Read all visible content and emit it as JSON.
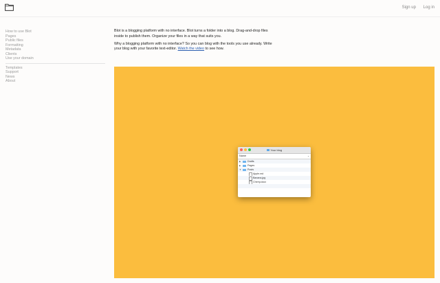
{
  "header": {
    "signup_label": "Sign up",
    "login_label": "Log in"
  },
  "sidebar": {
    "group1": [
      "How to use Blot",
      "Pages",
      "Public files",
      "Formatting",
      "Metadata",
      "Clients",
      "Use your domain"
    ],
    "group2": [
      "Templates",
      "Support",
      "News",
      "About"
    ]
  },
  "intro": {
    "paragraph1": "Blot is a blogging platform with no interface. Blot turns a folder into a blog. Drag-and-drop files inside to publish them. Organize your files in a way that suits you.",
    "paragraph2_prefix": "Why a blogging platform with no interface? So you can blog with the tools you use already. Write your blog with your favorite text-editor. ",
    "video_link": "Watch the video",
    "paragraph2_suffix": " to see how."
  },
  "video": {
    "background_color": "#fbbd3e",
    "finder": {
      "title": "Your blog",
      "column_header": "Name",
      "rows": [
        {
          "name": "Drafts",
          "kind": "folder",
          "state": "collapsed"
        },
        {
          "name": "Pages",
          "kind": "folder",
          "state": "collapsed"
        },
        {
          "name": "Posts",
          "kind": "folder",
          "state": "expanded"
        },
        {
          "name": "Apple.md",
          "kind": "file"
        },
        {
          "name": "Banana.jpg",
          "kind": "file"
        },
        {
          "name": "Cherry.docx",
          "kind": "file"
        }
      ]
    }
  }
}
